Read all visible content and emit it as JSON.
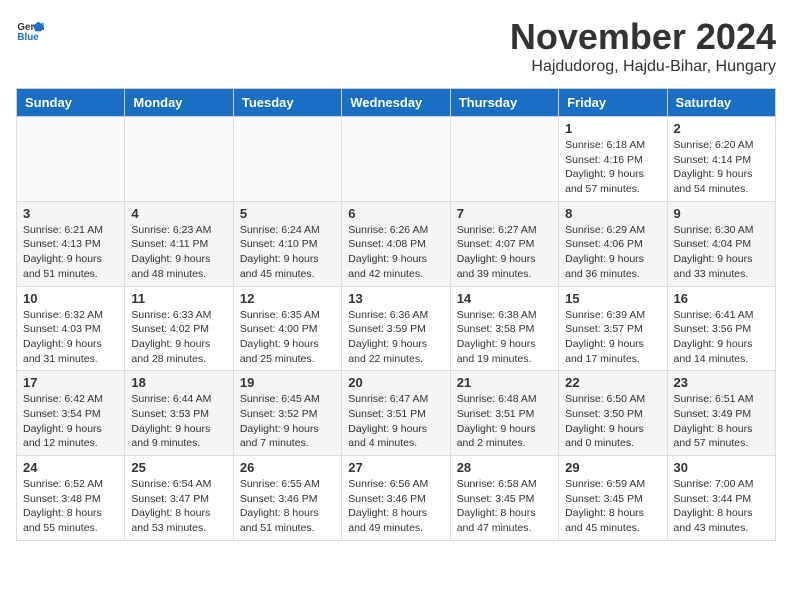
{
  "logo": {
    "text_general": "General",
    "text_blue": "Blue"
  },
  "title": "November 2024",
  "location": "Hajdudorog, Hajdu-Bihar, Hungary",
  "days_of_week": [
    "Sunday",
    "Monday",
    "Tuesday",
    "Wednesday",
    "Thursday",
    "Friday",
    "Saturday"
  ],
  "weeks": [
    [
      {
        "day": "",
        "info": ""
      },
      {
        "day": "",
        "info": ""
      },
      {
        "day": "",
        "info": ""
      },
      {
        "day": "",
        "info": ""
      },
      {
        "day": "",
        "info": ""
      },
      {
        "day": "1",
        "info": "Sunrise: 6:18 AM\nSunset: 4:16 PM\nDaylight: 9 hours and 57 minutes."
      },
      {
        "day": "2",
        "info": "Sunrise: 6:20 AM\nSunset: 4:14 PM\nDaylight: 9 hours and 54 minutes."
      }
    ],
    [
      {
        "day": "3",
        "info": "Sunrise: 6:21 AM\nSunset: 4:13 PM\nDaylight: 9 hours and 51 minutes."
      },
      {
        "day": "4",
        "info": "Sunrise: 6:23 AM\nSunset: 4:11 PM\nDaylight: 9 hours and 48 minutes."
      },
      {
        "day": "5",
        "info": "Sunrise: 6:24 AM\nSunset: 4:10 PM\nDaylight: 9 hours and 45 minutes."
      },
      {
        "day": "6",
        "info": "Sunrise: 6:26 AM\nSunset: 4:08 PM\nDaylight: 9 hours and 42 minutes."
      },
      {
        "day": "7",
        "info": "Sunrise: 6:27 AM\nSunset: 4:07 PM\nDaylight: 9 hours and 39 minutes."
      },
      {
        "day": "8",
        "info": "Sunrise: 6:29 AM\nSunset: 4:06 PM\nDaylight: 9 hours and 36 minutes."
      },
      {
        "day": "9",
        "info": "Sunrise: 6:30 AM\nSunset: 4:04 PM\nDaylight: 9 hours and 33 minutes."
      }
    ],
    [
      {
        "day": "10",
        "info": "Sunrise: 6:32 AM\nSunset: 4:03 PM\nDaylight: 9 hours and 31 minutes."
      },
      {
        "day": "11",
        "info": "Sunrise: 6:33 AM\nSunset: 4:02 PM\nDaylight: 9 hours and 28 minutes."
      },
      {
        "day": "12",
        "info": "Sunrise: 6:35 AM\nSunset: 4:00 PM\nDaylight: 9 hours and 25 minutes."
      },
      {
        "day": "13",
        "info": "Sunrise: 6:36 AM\nSunset: 3:59 PM\nDaylight: 9 hours and 22 minutes."
      },
      {
        "day": "14",
        "info": "Sunrise: 6:38 AM\nSunset: 3:58 PM\nDaylight: 9 hours and 19 minutes."
      },
      {
        "day": "15",
        "info": "Sunrise: 6:39 AM\nSunset: 3:57 PM\nDaylight: 9 hours and 17 minutes."
      },
      {
        "day": "16",
        "info": "Sunrise: 6:41 AM\nSunset: 3:56 PM\nDaylight: 9 hours and 14 minutes."
      }
    ],
    [
      {
        "day": "17",
        "info": "Sunrise: 6:42 AM\nSunset: 3:54 PM\nDaylight: 9 hours and 12 minutes."
      },
      {
        "day": "18",
        "info": "Sunrise: 6:44 AM\nSunset: 3:53 PM\nDaylight: 9 hours and 9 minutes."
      },
      {
        "day": "19",
        "info": "Sunrise: 6:45 AM\nSunset: 3:52 PM\nDaylight: 9 hours and 7 minutes."
      },
      {
        "day": "20",
        "info": "Sunrise: 6:47 AM\nSunset: 3:51 PM\nDaylight: 9 hours and 4 minutes."
      },
      {
        "day": "21",
        "info": "Sunrise: 6:48 AM\nSunset: 3:51 PM\nDaylight: 9 hours and 2 minutes."
      },
      {
        "day": "22",
        "info": "Sunrise: 6:50 AM\nSunset: 3:50 PM\nDaylight: 9 hours and 0 minutes."
      },
      {
        "day": "23",
        "info": "Sunrise: 6:51 AM\nSunset: 3:49 PM\nDaylight: 8 hours and 57 minutes."
      }
    ],
    [
      {
        "day": "24",
        "info": "Sunrise: 6:52 AM\nSunset: 3:48 PM\nDaylight: 8 hours and 55 minutes."
      },
      {
        "day": "25",
        "info": "Sunrise: 6:54 AM\nSunset: 3:47 PM\nDaylight: 8 hours and 53 minutes."
      },
      {
        "day": "26",
        "info": "Sunrise: 6:55 AM\nSunset: 3:46 PM\nDaylight: 8 hours and 51 minutes."
      },
      {
        "day": "27",
        "info": "Sunrise: 6:56 AM\nSunset: 3:46 PM\nDaylight: 8 hours and 49 minutes."
      },
      {
        "day": "28",
        "info": "Sunrise: 6:58 AM\nSunset: 3:45 PM\nDaylight: 8 hours and 47 minutes."
      },
      {
        "day": "29",
        "info": "Sunrise: 6:59 AM\nSunset: 3:45 PM\nDaylight: 8 hours and 45 minutes."
      },
      {
        "day": "30",
        "info": "Sunrise: 7:00 AM\nSunset: 3:44 PM\nDaylight: 8 hours and 43 minutes."
      }
    ]
  ]
}
